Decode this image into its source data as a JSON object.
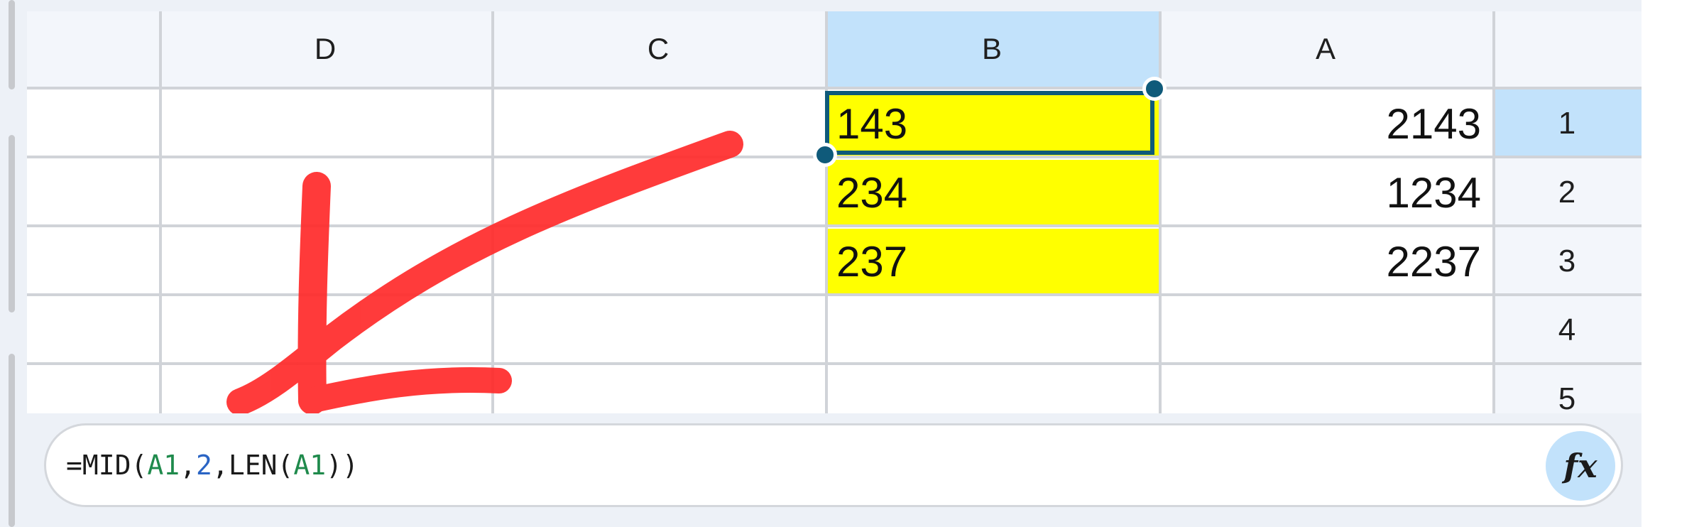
{
  "columns": [
    {
      "id": "D",
      "label": "D",
      "selected": false
    },
    {
      "id": "C",
      "label": "C",
      "selected": false
    },
    {
      "id": "B",
      "label": "B",
      "selected": true
    },
    {
      "id": "A",
      "label": "A",
      "selected": false
    }
  ],
  "rows": [
    {
      "label": "1",
      "selected": true
    },
    {
      "label": "2",
      "selected": false
    },
    {
      "label": "3",
      "selected": false
    },
    {
      "label": "4",
      "selected": false
    },
    {
      "label": "5",
      "selected": false
    }
  ],
  "cells": {
    "A1": "2143",
    "A2": "1234",
    "A3": "2237",
    "B1": "143",
    "B2": "234",
    "B3": "237"
  },
  "highlight_color": "#ffff00",
  "selection_color": "#0f5a7a",
  "header_selected_color": "#c2e2fb",
  "annotation": {
    "type": "arrow",
    "color": "#ff2a2a",
    "direction": "down-left"
  },
  "formula": {
    "text": "=MID(A1,2,LEN(A1))",
    "parts": [
      "=MID(",
      "A1",
      ",",
      "2",
      ",LEN(",
      "A1",
      "))"
    ]
  },
  "fx_button": {
    "label": "fx",
    "icon": "function-icon"
  }
}
